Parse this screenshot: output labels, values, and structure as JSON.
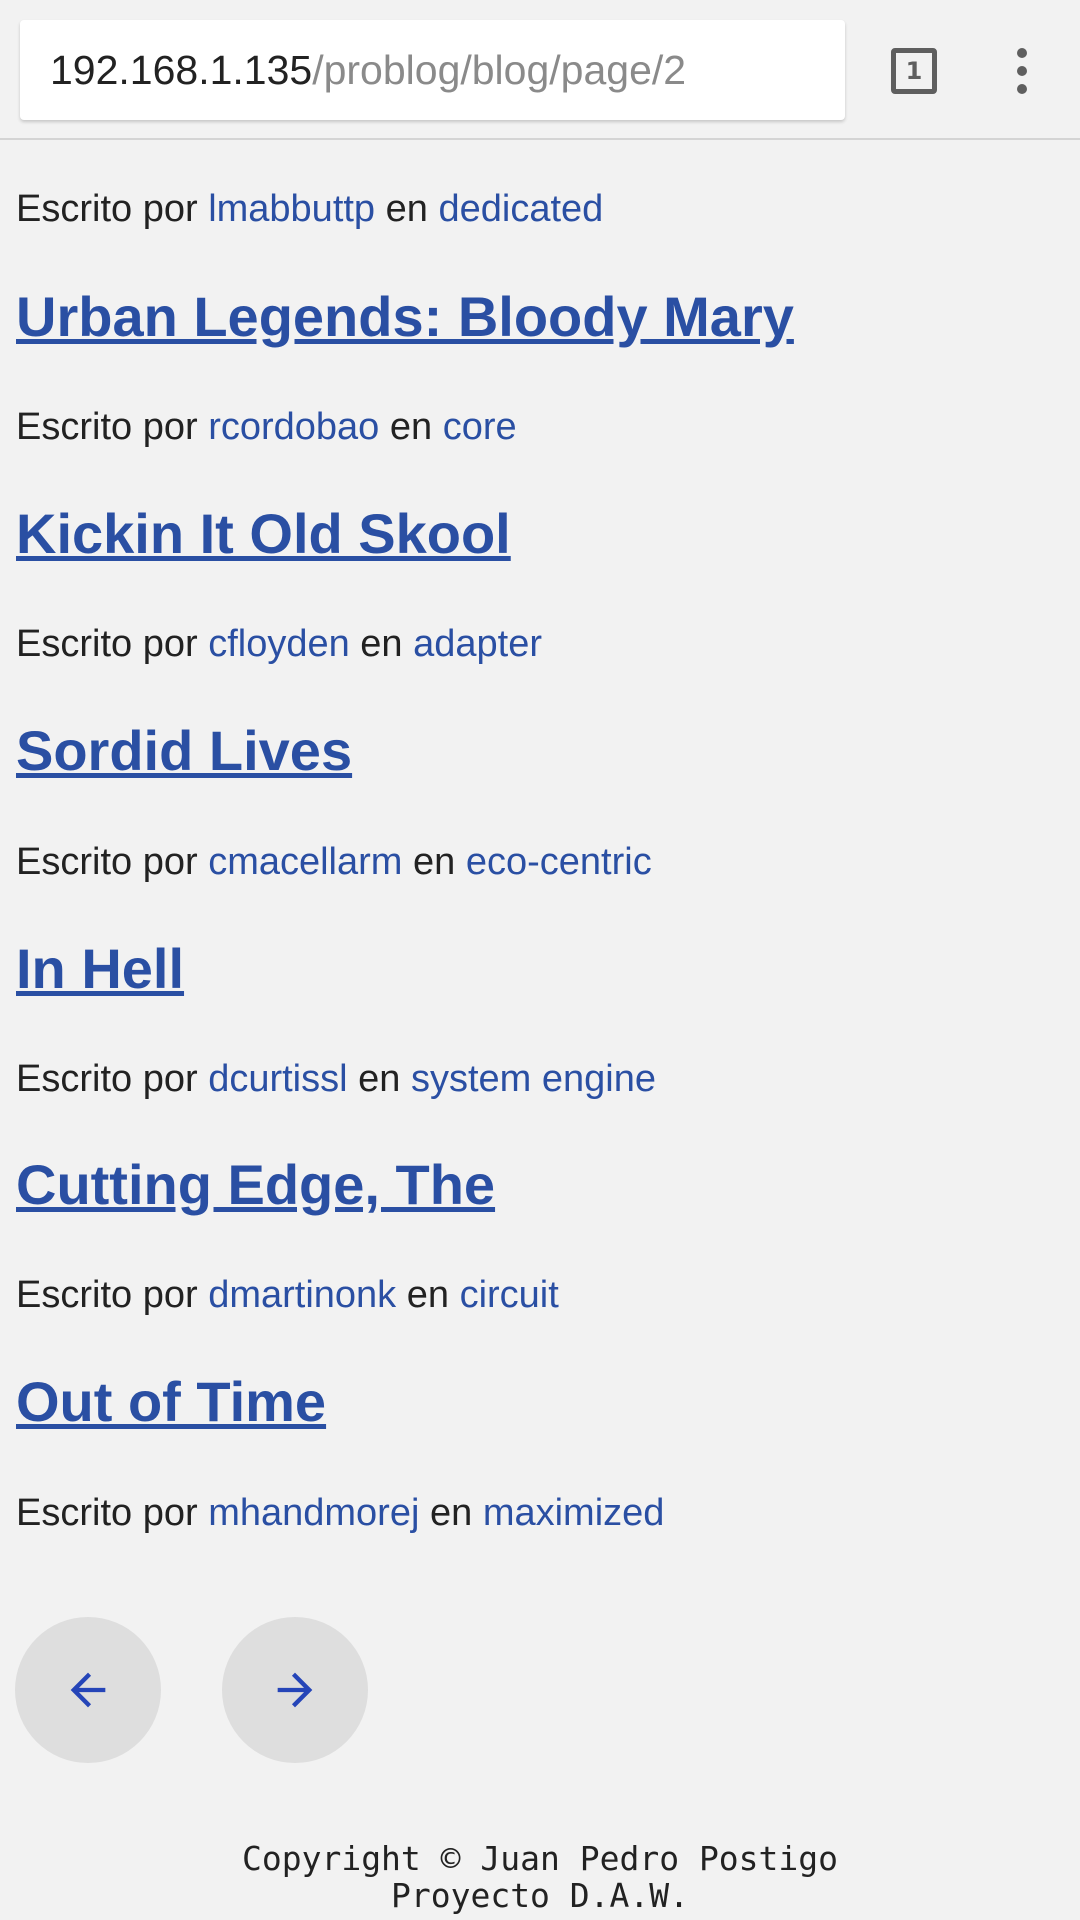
{
  "browser": {
    "url_host": "192.168.1.135",
    "url_path": "/problog/blog/page/2",
    "tab_count": "1",
    "menu_icon": "more-vert-icon"
  },
  "posts": {
    "meta_prefix": "Escrito por",
    "meta_joiner": "en",
    "top_meta": {
      "author": "lmabbuttp",
      "category": "dedicated"
    },
    "items": [
      {
        "title": "Urban Legends: Bloody Mary",
        "author": "rcordobao",
        "category": "core"
      },
      {
        "title": "Kickin It Old Skool",
        "author": "cfloyden",
        "category": "adapter"
      },
      {
        "title": "Sordid Lives",
        "author": "cmacellarm",
        "category": "eco-centric"
      },
      {
        "title": "In Hell",
        "author": "dcurtissl",
        "category": "system engine"
      },
      {
        "title": "Cutting Edge, The",
        "author": "dmartinonk",
        "category": "circuit"
      },
      {
        "title": "Out of Time",
        "author": "mhandmorej",
        "category": "maximized"
      }
    ]
  },
  "pagination": {
    "prev_icon": "arrow-left-icon",
    "next_icon": "arrow-right-icon"
  },
  "footer": {
    "copyright": "Copyright © Juan Pedro Postigo",
    "project": "Proyecto D.A.W."
  },
  "colors": {
    "link": "#2a4fa3",
    "background": "#f2f2f2",
    "nav_button": "#dedede",
    "nav_arrow": "#2545b8"
  }
}
